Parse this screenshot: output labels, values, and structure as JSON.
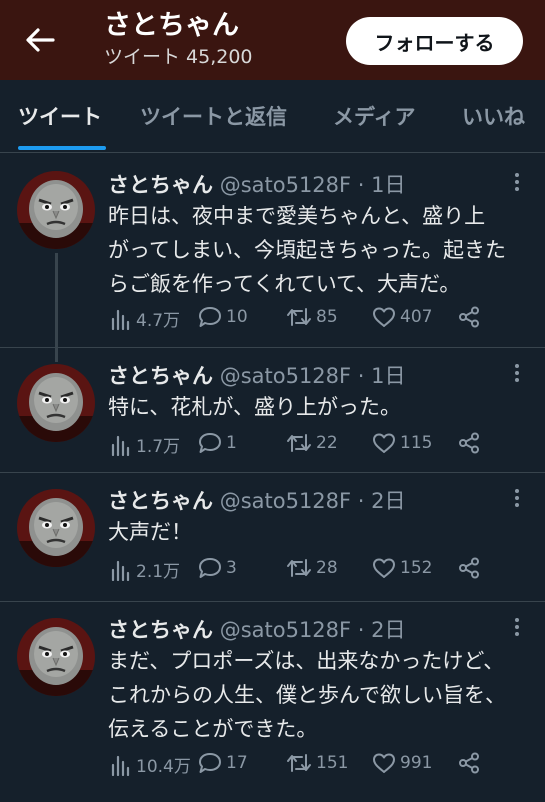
{
  "header": {
    "title": "さとちゃん",
    "subtitle": "ツイート 45,200",
    "follow_label": "フォローする",
    "bg_color": "#3a1510"
  },
  "tabs": [
    {
      "label": "ツイート",
      "active": true
    },
    {
      "label": "ツイートと返信",
      "active": false
    },
    {
      "label": "メディア",
      "active": false
    },
    {
      "label": "いいね",
      "active": false
    }
  ],
  "accent_color": "#1d9bf0",
  "tweets": [
    {
      "name": "さとちゃん",
      "meta": "@sato5128F · 1日",
      "text": "昨日は、夜中まで愛美ちゃんと、盛り上\nがってしまい、今頃起きちゃった。起きた\nらご飯を作ってくれていて、大声だ。",
      "views": "4.7万",
      "replies": "10",
      "retweets": "85",
      "likes": "407"
    },
    {
      "name": "さとちゃん",
      "meta": "@sato5128F · 1日",
      "text": "特に、花札が、盛り上がった。",
      "views": "1.7万",
      "replies": "1",
      "retweets": "22",
      "likes": "115"
    },
    {
      "name": "さとちゃん",
      "meta": "@sato5128F · 2日",
      "text": "大声だ！",
      "views": "2.1万",
      "replies": "3",
      "retweets": "28",
      "likes": "152"
    },
    {
      "name": "さとちゃん",
      "meta": "@sato5128F · 2日",
      "text": "まだ、プロポーズは、出来なかったけど、\nこれからの人生、僕と歩んで欲しい旨を、\n伝えることができた。",
      "views": "10.4万",
      "replies": "17",
      "retweets": "151",
      "likes": "991"
    }
  ],
  "icons": {
    "back": "back-arrow-icon",
    "more": "more-dots-icon",
    "views": "views-bar-chart-icon",
    "reply": "reply-bubble-icon",
    "retweet": "retweet-icon",
    "like": "heart-icon",
    "share": "share-icon"
  }
}
